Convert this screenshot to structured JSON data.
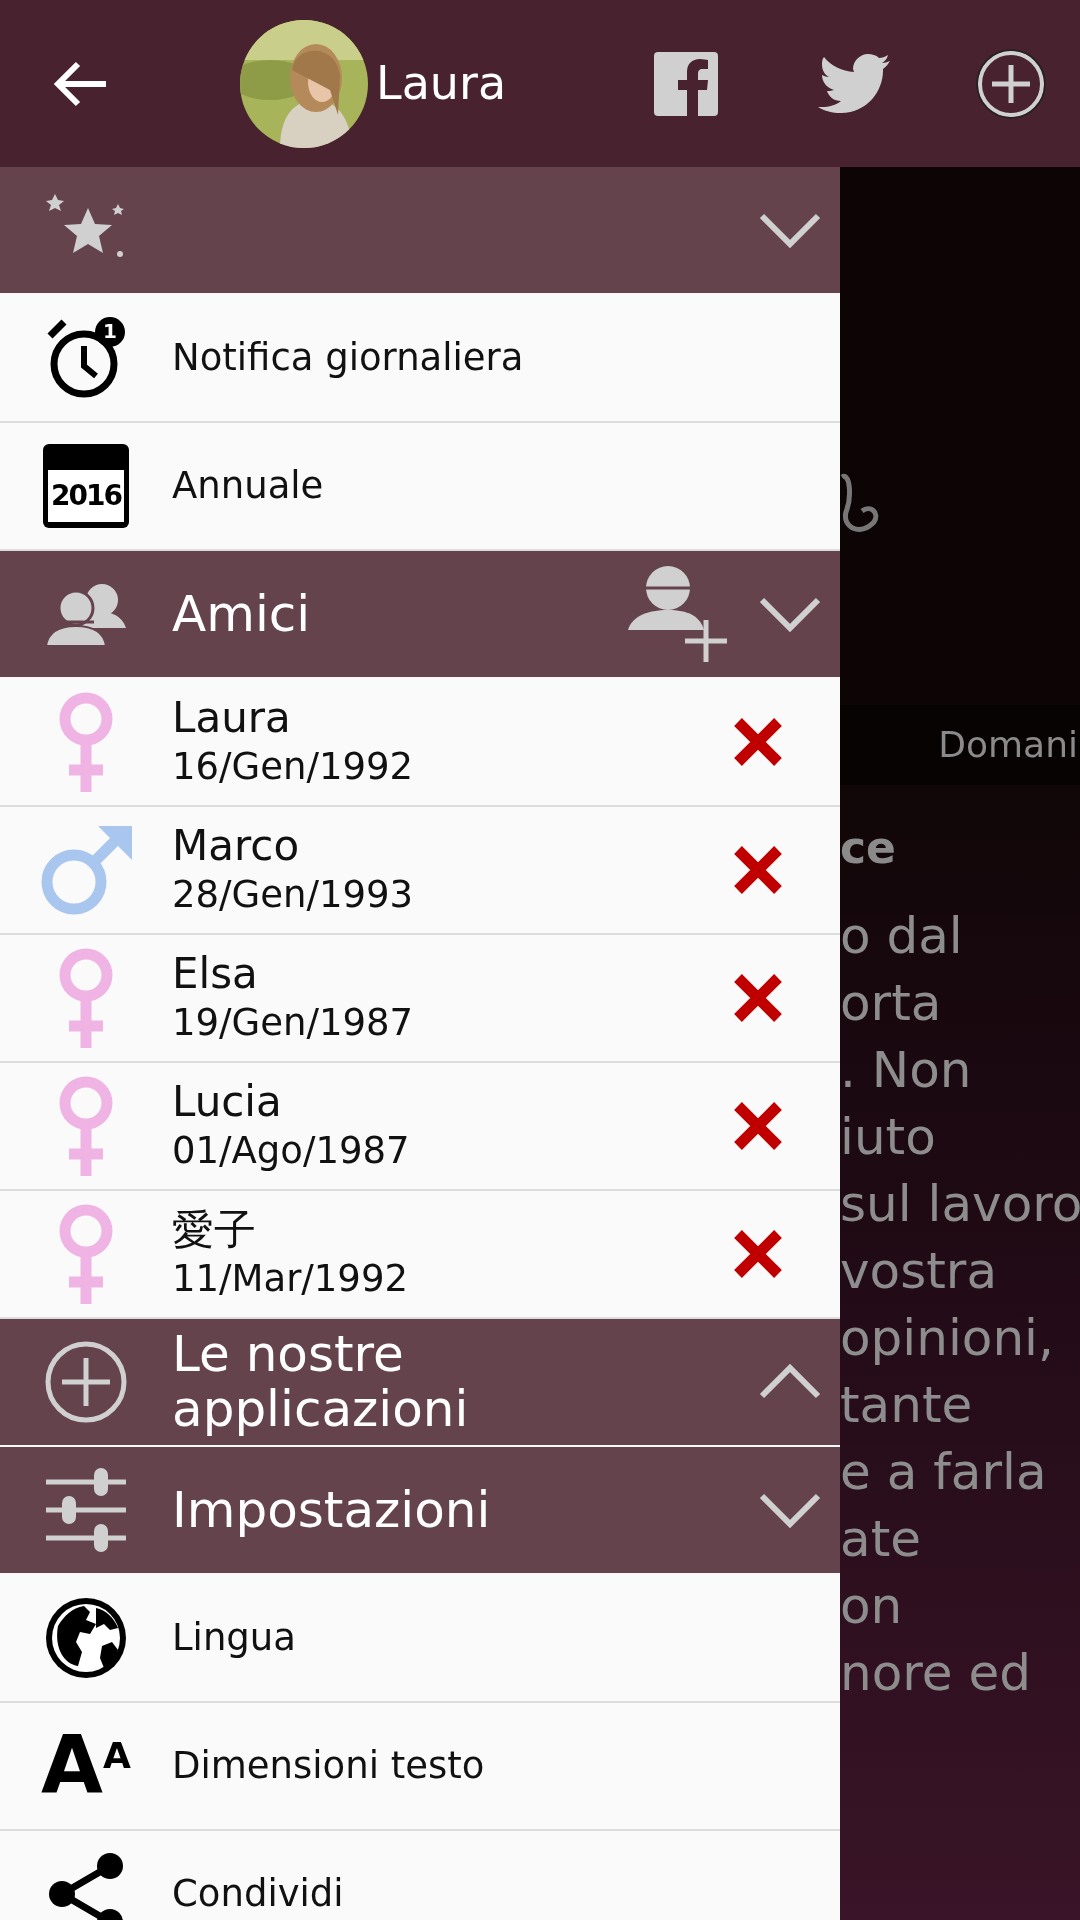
{
  "header": {
    "name": "Laura"
  },
  "sections": [
    {
      "kind": "favorites",
      "expanded": true,
      "items": [
        {
          "kind": "alarm",
          "label": "Notifica giornaliera",
          "badge": "1"
        },
        {
          "kind": "calendar",
          "label": "Annuale",
          "badge": "2016"
        }
      ]
    },
    {
      "kind": "friends",
      "title": "Amici",
      "expanded": true,
      "friends": [
        {
          "kind": "female",
          "name": "Laura",
          "date": "16/Gen/1992"
        },
        {
          "kind": "male",
          "name": "Marco",
          "date": "28/Gen/1993"
        },
        {
          "kind": "female",
          "name": "Elsa",
          "date": "19/Gen/1987"
        },
        {
          "kind": "female",
          "name": "Lucia",
          "date": "01/Ago/1987"
        },
        {
          "kind": "female",
          "name": "愛子",
          "date": "11/Mar/1992"
        }
      ]
    },
    {
      "kind": "apps",
      "title": "Le nostre applicazioni",
      "expanded": false
    },
    {
      "kind": "settings",
      "title": "Impostazioni",
      "expanded": true,
      "items": [
        {
          "kind": "globe",
          "label": "Lingua"
        },
        {
          "kind": "textsize",
          "label": "Dimensioni testo",
          "glyphs": [
            "A",
            "A"
          ]
        },
        {
          "kind": "share",
          "label": "Condividi"
        }
      ]
    }
  ],
  "background": {
    "tab": "Domani",
    "heading": "ce",
    "lines": [
      "o dal",
      "orta",
      ". Non",
      "iuto",
      "sul lavoro",
      "vostra",
      "opinioni,",
      "tante",
      "e a farla",
      "ate",
      "on",
      "nore ed"
    ]
  }
}
